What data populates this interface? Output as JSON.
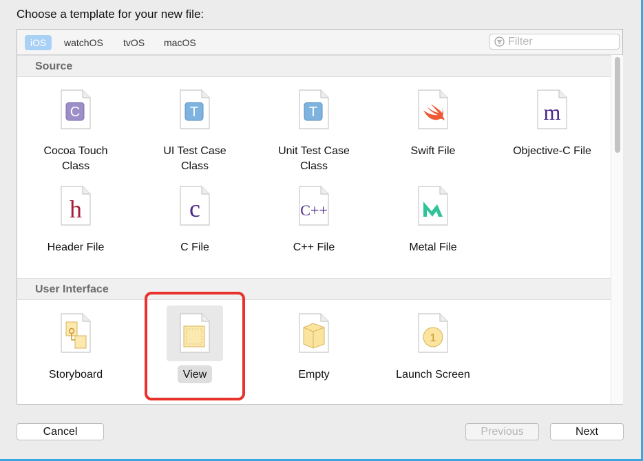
{
  "dialog": {
    "prompt": "Choose a template for your new file:"
  },
  "platforms": [
    {
      "label": "iOS",
      "selected": true
    },
    {
      "label": "watchOS",
      "selected": false
    },
    {
      "label": "tvOS",
      "selected": false
    },
    {
      "label": "macOS",
      "selected": false
    }
  ],
  "filter": {
    "placeholder": "Filter",
    "value": ""
  },
  "sections": {
    "source": {
      "title": "Source",
      "items": [
        {
          "line1": "Cocoa Touch",
          "line2": "Class",
          "icon": "cocoa-touch-class-icon"
        },
        {
          "line1": "UI Test Case",
          "line2": "Class",
          "icon": "ui-test-case-class-icon"
        },
        {
          "line1": "Unit Test Case",
          "line2": "Class",
          "icon": "unit-test-case-class-icon"
        },
        {
          "line1": "Swift File",
          "line2": "",
          "icon": "swift-file-icon"
        },
        {
          "line1": "Objective-C File",
          "line2": "",
          "icon": "objective-c-file-icon"
        },
        {
          "line1": "Header File",
          "line2": "",
          "icon": "header-file-icon"
        },
        {
          "line1": "C File",
          "line2": "",
          "icon": "c-file-icon"
        },
        {
          "line1": "C++ File",
          "line2": "",
          "icon": "cpp-file-icon"
        },
        {
          "line1": "Metal File",
          "line2": "",
          "icon": "metal-file-icon"
        }
      ],
      "glyphs": {
        "cocoa": "C",
        "uitest": "T",
        "unittest": "T",
        "objc": "m",
        "header": "h",
        "cfile": "c",
        "cpp": "C++",
        "launch": "1"
      }
    },
    "user_interface": {
      "title": "User Interface",
      "items": [
        {
          "line1": "Storyboard",
          "icon": "storyboard-icon"
        },
        {
          "line1": "View",
          "icon": "view-icon",
          "selected": true
        },
        {
          "line1": "Empty",
          "icon": "empty-icon"
        },
        {
          "line1": "Launch Screen",
          "icon": "launch-screen-icon"
        }
      ]
    }
  },
  "buttons": {
    "cancel": "Cancel",
    "previous": "Previous",
    "next": "Next"
  },
  "colors": {
    "selected_tab": "#a9d1f6",
    "highlight": "#e8322b",
    "window_frame": "#3aa6e0"
  }
}
